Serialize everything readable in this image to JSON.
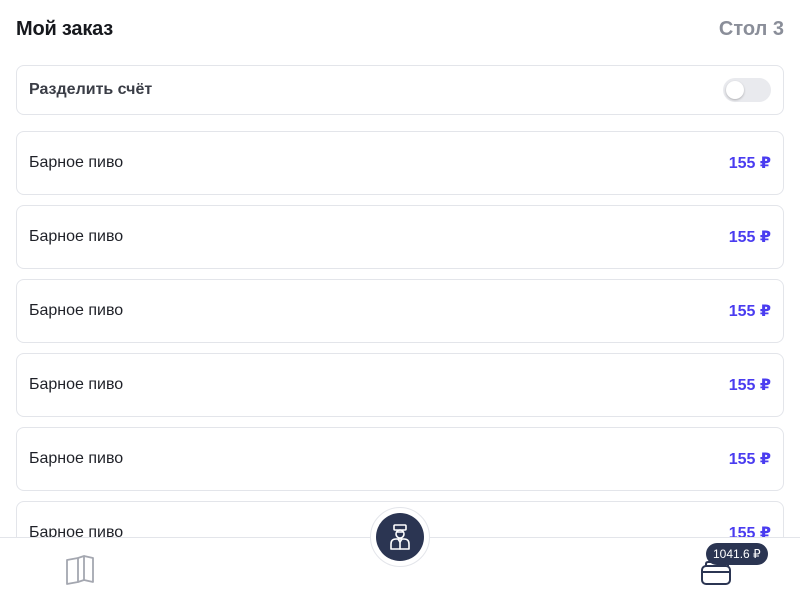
{
  "header": {
    "title": "Мой заказ",
    "table": "Стол 3"
  },
  "split_bill": {
    "label": "Разделить счёт",
    "enabled": false
  },
  "items": [
    {
      "name": "Барное пиво",
      "price": "155 ₽"
    },
    {
      "name": "Барное пиво",
      "price": "155 ₽"
    },
    {
      "name": "Барное пиво",
      "price": "155 ₽"
    },
    {
      "name": "Барное пиво",
      "price": "155 ₽"
    },
    {
      "name": "Барное пиво",
      "price": "155 ₽"
    },
    {
      "name": "Барное пиво",
      "price": "155 ₽"
    }
  ],
  "bottom_nav": {
    "menu_icon": "book-icon",
    "waiter_icon": "waiter-icon",
    "pay_icon": "wallet-icon",
    "total_badge": "1041.6 ₽"
  },
  "colors": {
    "accent": "#4a3cf0",
    "dark": "#2b3552",
    "border": "#e3e5ea",
    "muted": "#8a8e99"
  }
}
